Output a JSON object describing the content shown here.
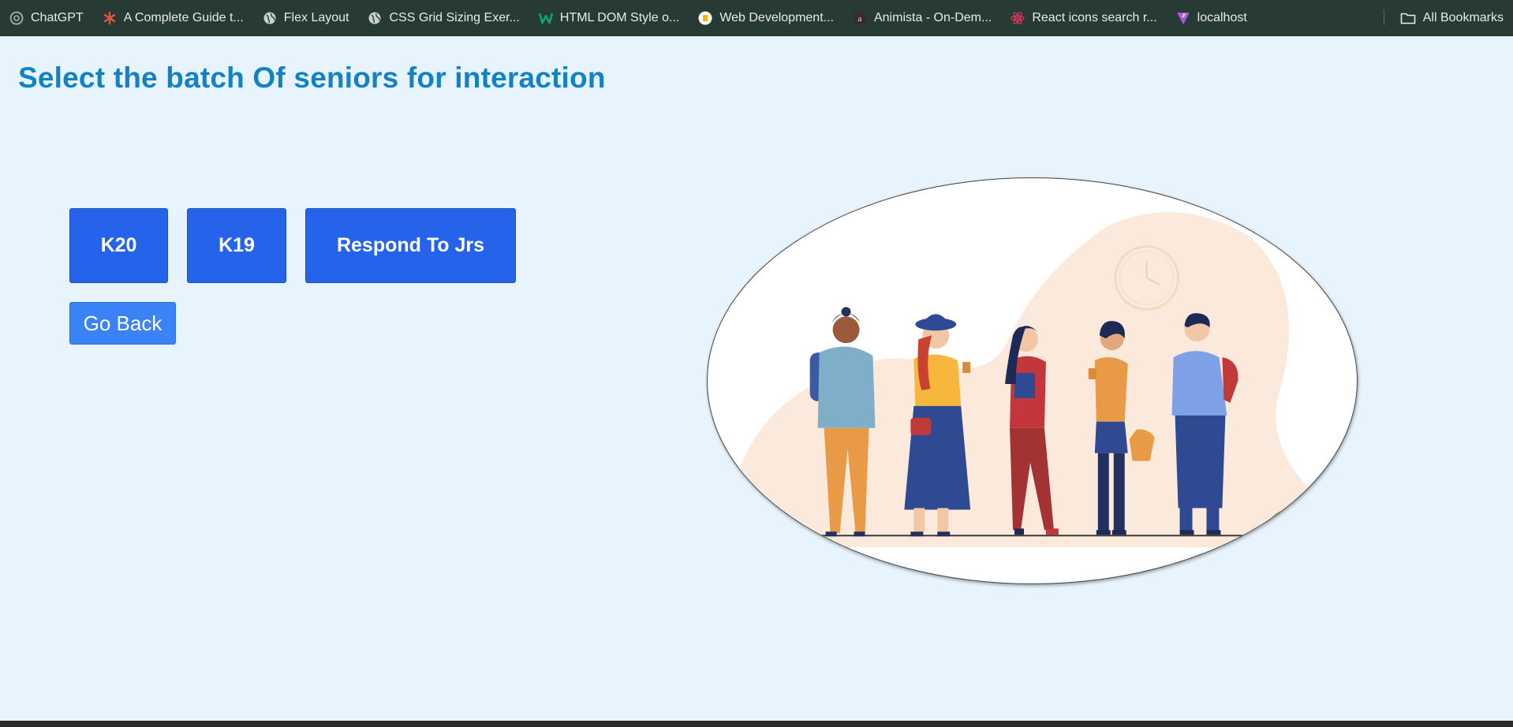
{
  "bookmarks": [
    {
      "label": "ChatGPT",
      "icon": "chatgpt-icon",
      "color": "#9fb5ad"
    },
    {
      "label": "A Complete Guide t...",
      "icon": "asterisk-icon",
      "color": "#e8553c"
    },
    {
      "label": "Flex Layout",
      "icon": "globe-icon",
      "color": "#c9d1ce"
    },
    {
      "label": "CSS Grid Sizing Exer...",
      "icon": "globe-icon",
      "color": "#c9d1ce"
    },
    {
      "label": "HTML DOM Style o...",
      "icon": "w3schools-icon",
      "color": "#04aa6d"
    },
    {
      "label": "Web Development...",
      "icon": "cup-icon",
      "color": "#f4b400"
    },
    {
      "label": "Animista - On-Dem...",
      "icon": "animista-icon",
      "color": "#e6ece9"
    },
    {
      "label": "React icons search r...",
      "icon": "react-icon",
      "color": "#e0335f"
    },
    {
      "label": "localhost",
      "icon": "vite-icon",
      "color": "#a855f7"
    }
  ],
  "all_bookmarks_label": "All Bookmarks",
  "page": {
    "title": "Select the batch Of seniors for interaction",
    "buttons": {
      "k20": "K20",
      "k19": "K19",
      "respond": "Respond To Jrs",
      "back": "Go Back"
    }
  },
  "colors": {
    "title": "#1382c4",
    "batch_button": "#2563eb",
    "back_button": "#3b82f6",
    "page_background": "#e8f4fd",
    "bookmarks_bar": "#283a34"
  }
}
